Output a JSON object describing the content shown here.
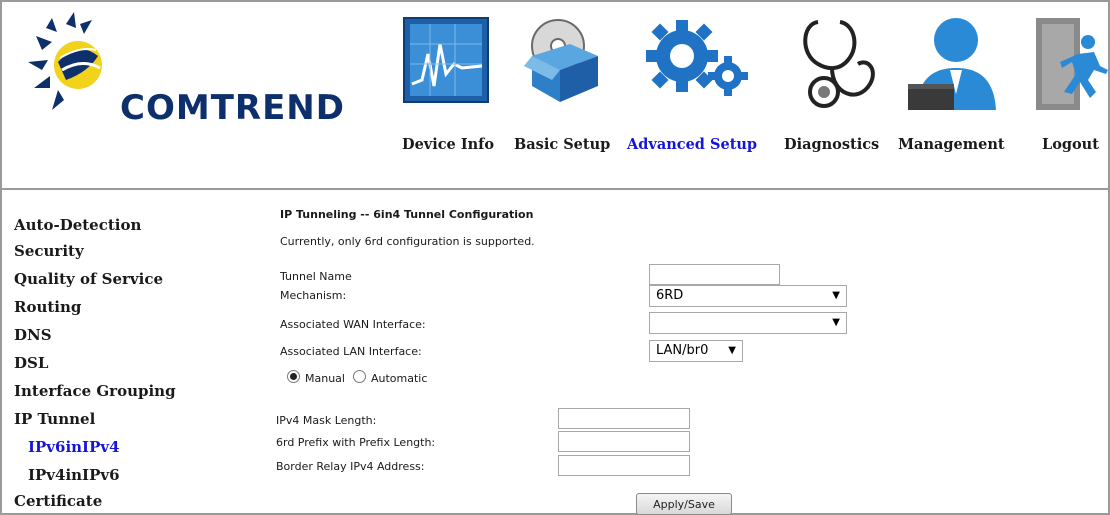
{
  "brand": {
    "name": "COMTREND"
  },
  "nav": [
    {
      "label": "Device Info",
      "icon": "device-info-chart-icon"
    },
    {
      "label": "Basic Setup",
      "icon": "basic-setup-disc-box-icon"
    },
    {
      "label": "Advanced Setup",
      "icon": "advanced-setup-gears-icon",
      "active": true
    },
    {
      "label": "Diagnostics",
      "icon": "diagnostics-stethoscope-icon"
    },
    {
      "label": "Management",
      "icon": "management-user-icon"
    },
    {
      "label": "Logout",
      "icon": "logout-exit-icon"
    }
  ],
  "sidebar": [
    {
      "label": "Auto-Detection"
    },
    {
      "label": "Security"
    },
    {
      "label": "Quality of Service"
    },
    {
      "label": "Routing"
    },
    {
      "label": "DNS"
    },
    {
      "label": "DSL"
    },
    {
      "label": "Interface Grouping"
    },
    {
      "label": "IP Tunnel"
    },
    {
      "label": "IPv6inIPv4",
      "active": true
    },
    {
      "label": "IPv4inIPv6"
    },
    {
      "label": "Certificate"
    }
  ],
  "form": {
    "title": "IP Tunneling -- 6in4 Tunnel Configuration",
    "note": "Currently, only 6rd configuration is supported.",
    "tunnel_name_label": "Tunnel Name",
    "tunnel_name_value": "",
    "mechanism_label": "Mechanism:",
    "mechanism_value": "6RD",
    "wan_label": "Associated WAN Interface:",
    "wan_value": "",
    "lan_label": "Associated LAN Interface:",
    "lan_value": "LAN/br0",
    "mode_manual": "Manual",
    "mode_automatic": "Automatic",
    "mode_selected": "Manual",
    "mask_label": "IPv4 Mask Length:",
    "mask_value": "",
    "prefix_label": "6rd Prefix with Prefix Length:",
    "prefix_value": "",
    "relay_label": "Border Relay IPv4 Address:",
    "relay_value": "",
    "apply_label": "Apply/Save"
  },
  "colors": {
    "brand_navy": "#0d2f6b",
    "active_link": "#1515d8",
    "icon_blue": "#2d7fc8"
  }
}
